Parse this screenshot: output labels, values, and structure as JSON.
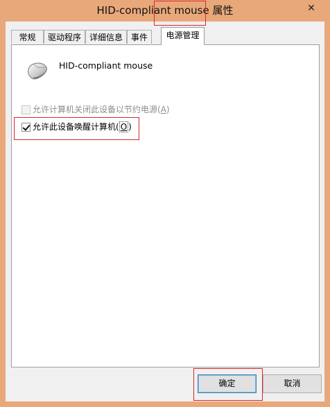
{
  "window": {
    "title": "HID-compliant mouse 属性",
    "close_glyph": "✕"
  },
  "tabs": [
    {
      "label": "常规"
    },
    {
      "label": "驱动程序"
    },
    {
      "label": "详细信息"
    },
    {
      "label": "事件"
    },
    {
      "label": "电源管理",
      "active": true
    }
  ],
  "device": {
    "name": "HID-compliant mouse",
    "icon": "mouse-icon"
  },
  "options": {
    "allow_off": {
      "label": "允许计算机关闭此设备以节约电源(",
      "accel": "A",
      "tail": ")",
      "checked": false,
      "enabled": false
    },
    "allow_wake": {
      "label": "允许此设备唤醒计算机(",
      "accel": "O",
      "tail": ")",
      "checked": true,
      "enabled": true
    }
  },
  "buttons": {
    "ok": "确定",
    "cancel": "取消"
  },
  "colors": {
    "titlebar": "#e8a87a",
    "highlight": "#d8262c"
  }
}
